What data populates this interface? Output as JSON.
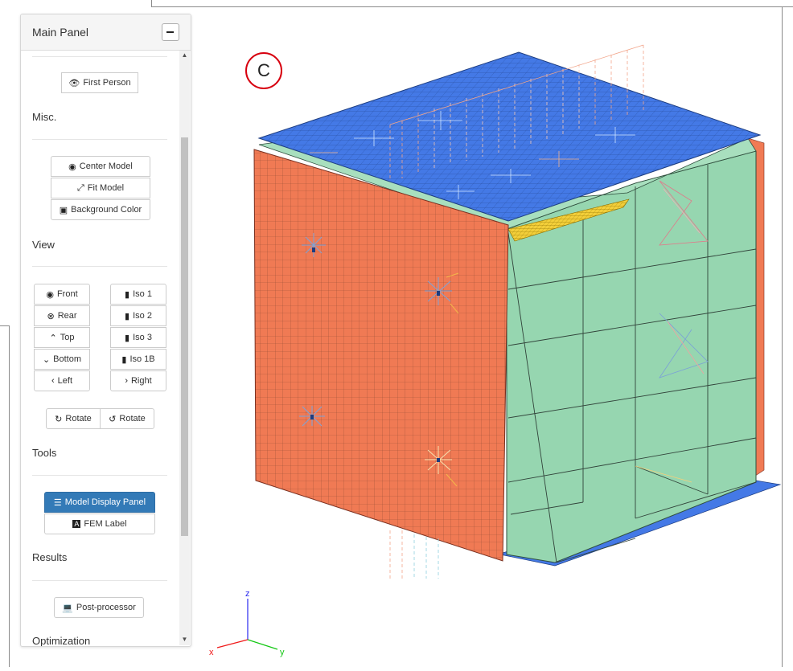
{
  "marker": {
    "letter": "C"
  },
  "panel": {
    "title": "Main Panel",
    "first_person": {
      "label": "First Person",
      "icon": "eye-icon"
    },
    "misc": {
      "label": "Misc.",
      "center_model": "Center Model",
      "fit_model": "Fit Model",
      "background_color": "Background Color"
    },
    "view": {
      "label": "View",
      "front": "Front",
      "rear": "Rear",
      "top": "Top",
      "bottom": "Bottom",
      "left": "Left",
      "right": "Right",
      "iso1": "Iso 1",
      "iso2": "Iso 2",
      "iso3": "Iso 3",
      "iso1b": "Iso 1B",
      "rotate_cw": "Rotate",
      "rotate_ccw": "Rotate"
    },
    "tools": {
      "label": "Tools",
      "model_display_panel": "Model Display Panel",
      "fem_label": "FEM Label"
    },
    "results": {
      "label": "Results",
      "post_processor": "Post-processor"
    },
    "optimization": {
      "label": "Optimization"
    }
  },
  "axes": {
    "x": "x",
    "y": "y",
    "z": "z"
  },
  "colors": {
    "top_plate": "#4479e6",
    "side_panel": "#f07a54",
    "frame_panel": "#96d6b0",
    "highlight_strip": "#f3cf3a",
    "marker_ring": "#d7000f",
    "primary_button": "#337ab7"
  }
}
